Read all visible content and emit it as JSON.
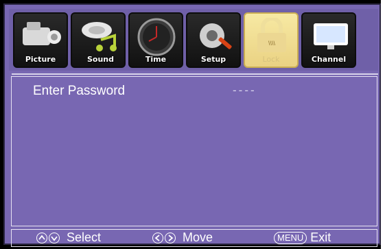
{
  "tabs": [
    {
      "label": "Picture",
      "icon": "camera-icon",
      "active": false
    },
    {
      "label": "Sound",
      "icon": "music-note-icon",
      "active": false
    },
    {
      "label": "Time",
      "icon": "clock-icon",
      "active": false
    },
    {
      "label": "Setup",
      "icon": "gear-wrench-icon",
      "active": false
    },
    {
      "label": "Lock",
      "icon": "padlock-icon",
      "active": true
    },
    {
      "label": "Channel",
      "icon": "monitor-icon",
      "active": false
    }
  ],
  "lock_menu": {
    "password_label": "Enter Password",
    "password_value": "----"
  },
  "footer": {
    "select_label": "Select",
    "move_label": "Move",
    "menu_key": "MENU",
    "exit_label": "Exit"
  },
  "colors": {
    "background": "#7867b2",
    "active_tab": "#f2e09a"
  }
}
